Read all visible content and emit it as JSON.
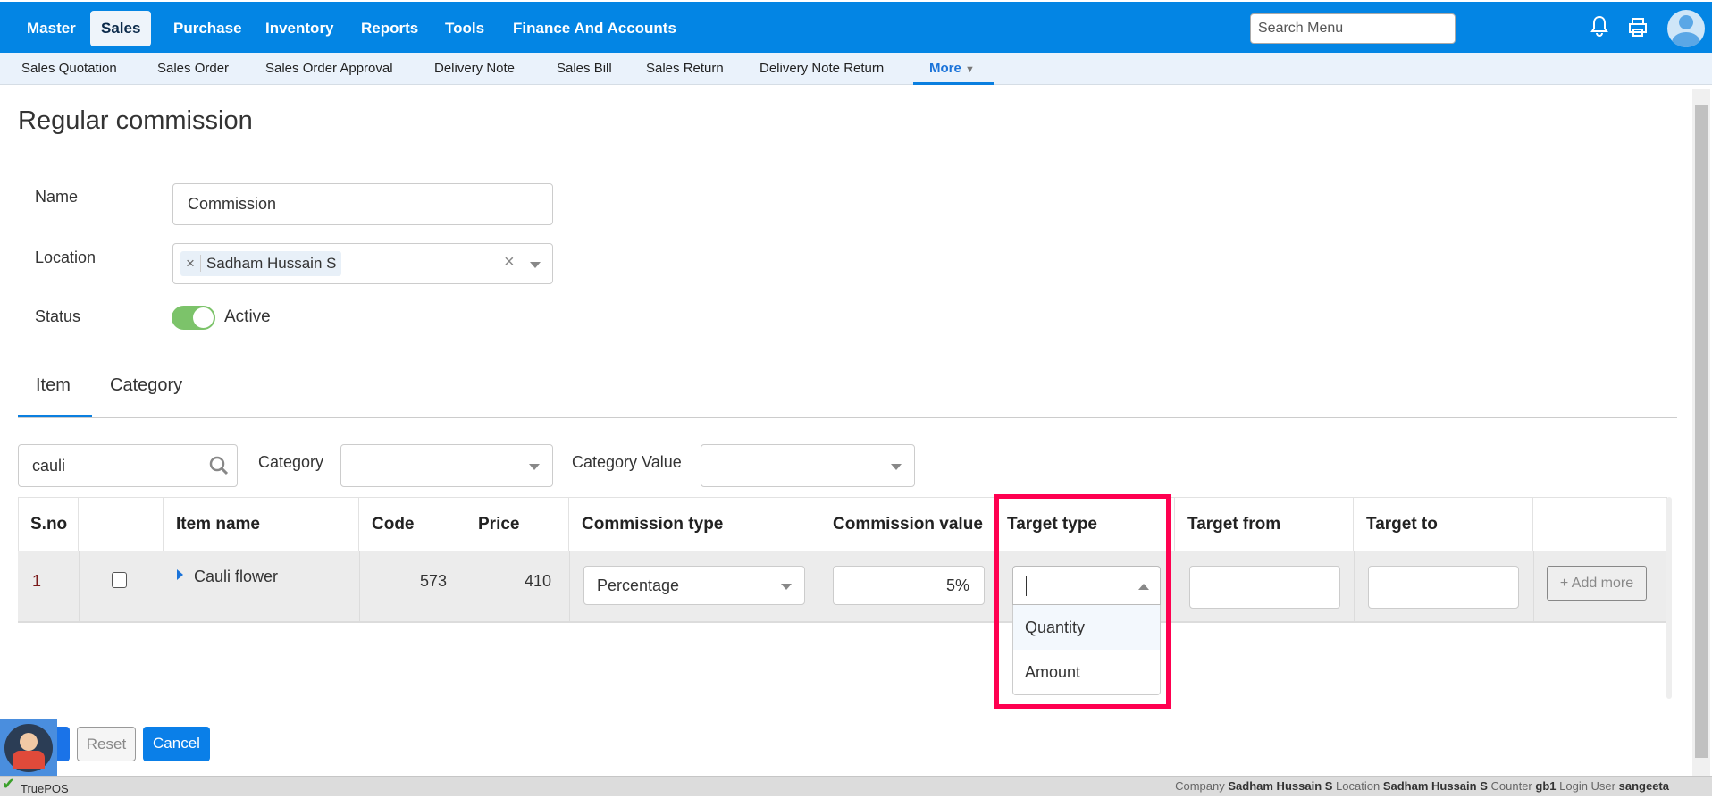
{
  "topnav": {
    "items": [
      "Master",
      "Sales",
      "Purchase",
      "Inventory",
      "Reports",
      "Tools",
      "Finance And Accounts"
    ],
    "active": "Sales",
    "search_placeholder": "Search Menu"
  },
  "subnav": {
    "items": [
      "Sales Quotation",
      "Sales Order",
      "Sales Order Approval",
      "Delivery Note",
      "Sales Bill",
      "Sales Return",
      "Delivery Note Return"
    ],
    "more": "More"
  },
  "page": {
    "title": "Regular commission"
  },
  "form": {
    "name_label": "Name",
    "name_value": "Commission",
    "location_label": "Location",
    "location_tag": "Sadham Hussain S",
    "status_label": "Status",
    "status_value": "Active",
    "status_on": true
  },
  "tabs": {
    "items": [
      "Item",
      "Category"
    ],
    "active": "Item"
  },
  "filters": {
    "search_value": "cauli",
    "category_label": "Category",
    "category_value_label": "Category Value"
  },
  "table": {
    "headers": [
      "S.no",
      "",
      "Item name",
      "Code",
      "Price",
      "Commission type",
      "Commission value",
      "Target type",
      "Target from",
      "Target to"
    ],
    "rows": [
      {
        "sno": "1",
        "item": "Cauli flower",
        "code": "573",
        "price": "410",
        "commission_type": "Percentage",
        "commission_value": "5%",
        "add_more": "+ Add more"
      }
    ]
  },
  "dropdown": {
    "options": [
      "Quantity",
      "Amount"
    ],
    "highlighted": "Quantity"
  },
  "buttons": {
    "reset": "Reset",
    "cancel": "Cancel"
  },
  "statusbar": {
    "app": "TruePOS",
    "company_label": "Company",
    "company": "Sadham Hussain S",
    "location_label": "Location",
    "location": "Sadham Hussain S",
    "counter_label": "Counter",
    "counter": "gb1",
    "user_label": "Login User",
    "user": "sangeeta"
  },
  "colors": {
    "primary": "#0385e4",
    "highlight_box": "#ff0050",
    "toggle": "#7cc36a"
  }
}
